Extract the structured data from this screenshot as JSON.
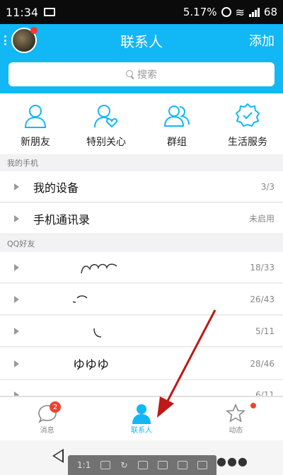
{
  "status_bar": {
    "time": "11:34",
    "speed": "5.17%",
    "battery": "68"
  },
  "header": {
    "title": "联系人",
    "add_label": "添加"
  },
  "search": {
    "placeholder": "搜索"
  },
  "quick_actions": [
    {
      "label": "新朋友",
      "icon": "new-friend-icon"
    },
    {
      "label": "特别关心",
      "icon": "special-care-icon"
    },
    {
      "label": "群组",
      "icon": "group-icon"
    },
    {
      "label": "生活服务",
      "icon": "life-service-icon"
    }
  ],
  "my_phone": {
    "section_label": "我的手机",
    "rows": [
      {
        "label": "我的设备",
        "count": "3/3"
      },
      {
        "label": "手机通讯录",
        "count": "未启用"
      }
    ]
  },
  "qq_friends": {
    "section_label": "QQ好友",
    "groups": [
      {
        "label": "",
        "count": "18/33"
      },
      {
        "label": "",
        "count": "26/43"
      },
      {
        "label": "",
        "count": "5/11"
      },
      {
        "label": "ゆゆゆ",
        "count": "28/46"
      },
      {
        "label": "",
        "count": "6/11"
      }
    ]
  },
  "tabbar": {
    "messages": {
      "label": "消息",
      "badge": "2"
    },
    "contacts": {
      "label": "联系人"
    },
    "moments": {
      "label": "动态"
    }
  },
  "screenshot_toolbar": {
    "ratio_label": "1:1"
  },
  "colors": {
    "accent": "#12b7f5",
    "badge": "#f0422f",
    "arrow": "#c01818"
  }
}
